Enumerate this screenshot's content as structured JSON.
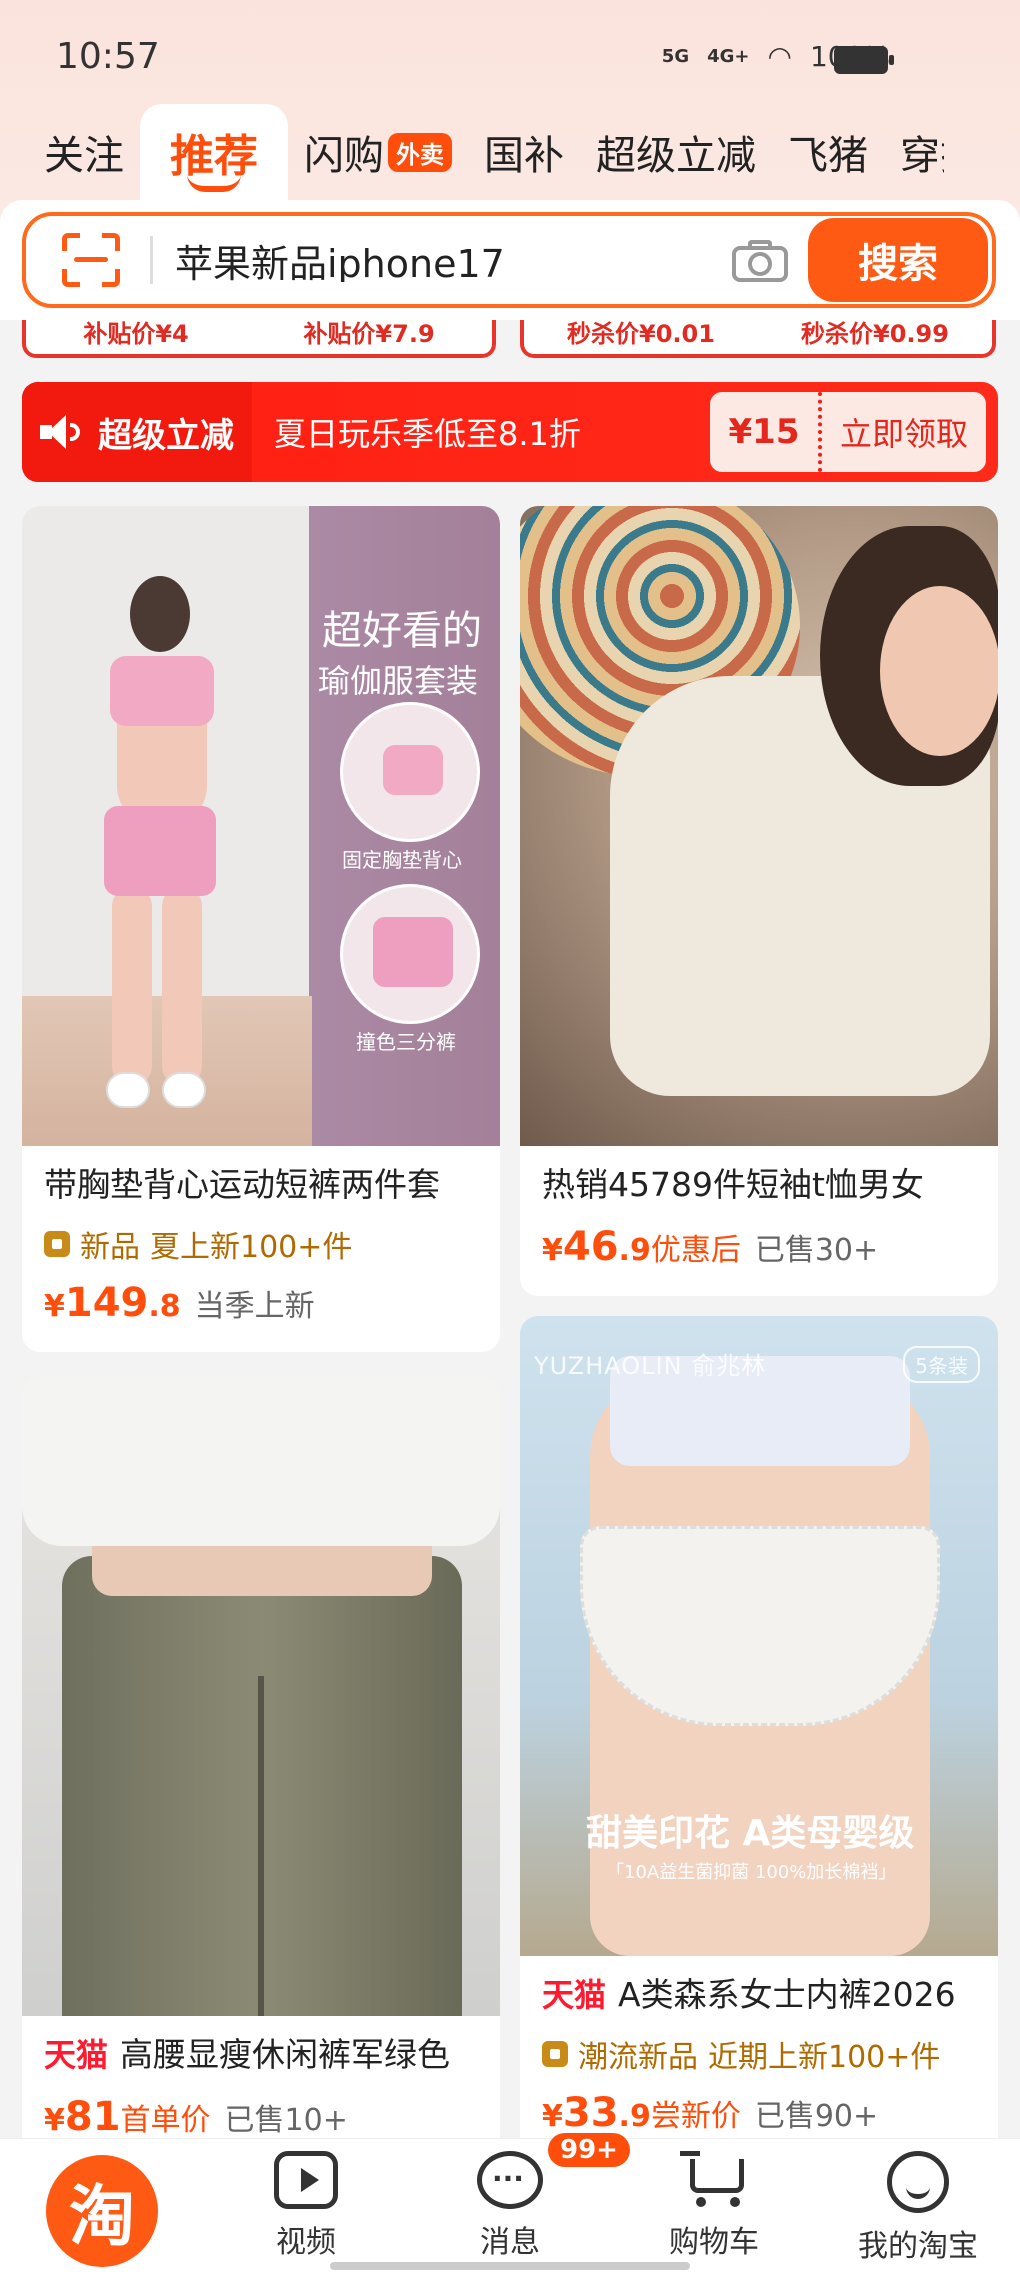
{
  "status": {
    "time": "10:57",
    "net1": "5G",
    "net2": "4G+",
    "battery": "100%"
  },
  "tabs": [
    {
      "label": "关注",
      "active": false
    },
    {
      "label": "推荐",
      "active": true
    },
    {
      "label": "闪购",
      "badge": "外卖"
    },
    {
      "label": "国补"
    },
    {
      "label": "超级立减"
    },
    {
      "label": "飞猪"
    },
    {
      "label": "穿搭"
    }
  ],
  "search": {
    "value": "苹果新品iphone17",
    "button": "搜索"
  },
  "peek": {
    "left": [
      "补贴价¥4",
      "补贴价¥7.9"
    ],
    "right": [
      "秒杀价¥0.01",
      "秒杀价¥0.99"
    ]
  },
  "promo": {
    "title": "超级立减",
    "subtitle": "夏日玩乐季低至8.1折",
    "coupon_amount": "¥15",
    "claim": "立即领取"
  },
  "products": [
    {
      "title": "带胸垫背心运动短裤两件套",
      "tag_new": "新品",
      "tag_text": "夏上新100+件",
      "price_yen": "¥",
      "price_int": "149",
      "price_dec": ".8",
      "note": "当季上新",
      "image_text1": "超好看的",
      "image_text2": "瑜伽服套装",
      "image_cap1": "固定胸垫背心",
      "image_cap2": "撞色三分裤"
    },
    {
      "title": "热销45789件短袖t恤男女",
      "price_yen": "¥",
      "price_int": "46",
      "price_dec": ".9",
      "price_note": "优惠后",
      "sold": "已售30+"
    },
    {
      "tmall": "天猫",
      "title": "高腰显瘦休闲裤军绿色",
      "price_yen": "¥",
      "price_int": "81",
      "price_dec": "",
      "price_note": "首单价",
      "sold": "已售10+"
    },
    {
      "tmall": "天猫",
      "title": "A类森系女士内裤2026",
      "tag_new": "潮流新品",
      "tag_text": "近期上新100+件",
      "price_yen": "¥",
      "price_int": "33",
      "price_dec": ".9",
      "price_note": "尝新价",
      "sold": "已售90+",
      "image_brand": "YUZHAOLIN 俞兆林",
      "image_chip": "5条装",
      "image_text1": "甜美印花 A类母婴级",
      "image_text2": "「10A益生菌抑菌 100%加长棉裆」"
    }
  ],
  "bottom_nav": [
    {
      "label": "淘"
    },
    {
      "label": "视频"
    },
    {
      "label": "消息",
      "badge": "99+"
    },
    {
      "label": "购物车"
    },
    {
      "label": "我的淘宝"
    }
  ],
  "colors": {
    "accent": "#ff5a13",
    "promo_red": "#ff1f12",
    "tmall_red": "#ff1a2f"
  }
}
